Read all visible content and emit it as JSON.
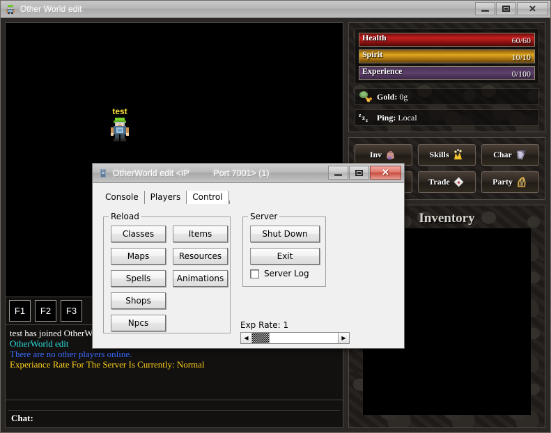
{
  "app_window": {
    "title": "Other World edit",
    "icon": "game-character-icon",
    "controls": {
      "minimize": "minimize-icon",
      "maximize": "maximize-icon",
      "close": "close-icon"
    }
  },
  "viewport": {
    "player_name": "test"
  },
  "hotkeys": [
    {
      "label": "F1"
    },
    {
      "label": "F2"
    },
    {
      "label": "F3"
    }
  ],
  "chat_log": {
    "lines": [
      {
        "text": "test has joined OtherWorld edit",
        "color": "#ffffff"
      },
      {
        "text": "OtherWorld edit",
        "color": "#2ae0e0"
      },
      {
        "text": "There are no other players online.",
        "color": "#3a6bff"
      },
      {
        "text": "Experiance Rate For The Server Is Currently: Normal",
        "color": "#ffd11a"
      }
    ]
  },
  "chat_input": {
    "label": "Chat:",
    "value": "",
    "placeholder": ""
  },
  "hud": {
    "bars": [
      {
        "name": "Health",
        "value": "60/60",
        "percent": 100,
        "color": "#c31f1f"
      },
      {
        "name": "Spirit",
        "value": "10/10",
        "percent": 100,
        "color": "#e0a61c"
      },
      {
        "name": "Experience",
        "value": "0/100",
        "percent": 0,
        "color": "#5d3f6b"
      }
    ],
    "info": [
      {
        "icon": "gold-coins-icon",
        "label": "Gold:",
        "value": "0g"
      },
      {
        "icon": "zzz-ping-icon",
        "label": "Ping:",
        "value": "Local"
      }
    ]
  },
  "menu_buttons": [
    {
      "label": "Inv",
      "icon": "bag-icon"
    },
    {
      "label": "Skills",
      "icon": "spell-sparkle-icon"
    },
    {
      "label": "Char",
      "icon": "armor-icon"
    },
    {
      "label": "",
      "icon": "scroll-icon"
    },
    {
      "label": "Trade",
      "icon": "envelope-icon"
    },
    {
      "label": "Party",
      "icon": "harp-icon"
    }
  ],
  "inventory": {
    "title": "Inventory"
  },
  "dialog": {
    "title": "OtherWorld edit <IP          Port 7001> (1)",
    "icon": "server-tower-icon",
    "controls": {
      "minimize": "minimize-icon",
      "maximize": "maximize-icon",
      "close": "close-icon"
    },
    "tabs": [
      {
        "label": "Console",
        "active": false
      },
      {
        "label": "Players",
        "active": false
      },
      {
        "label": "Control",
        "active": true
      }
    ],
    "reload_group": {
      "title": "Reload",
      "buttons": [
        {
          "label": "Classes"
        },
        {
          "label": "Items"
        },
        {
          "label": "Maps"
        },
        {
          "label": "Resources"
        },
        {
          "label": "Spells"
        },
        {
          "label": "Animations"
        },
        {
          "label": "Shops"
        },
        {
          "label": "Npcs"
        }
      ]
    },
    "server_group": {
      "title": "Server",
      "buttons": [
        {
          "label": "Shut Down"
        },
        {
          "label": "Exit"
        }
      ],
      "checkbox": {
        "label": "Server Log",
        "checked": false
      }
    },
    "exp_rate": {
      "label": "Exp Rate: 1",
      "value": 1,
      "left_arrow": "arrow-left-icon",
      "right_arrow": "arrow-right-icon"
    }
  }
}
